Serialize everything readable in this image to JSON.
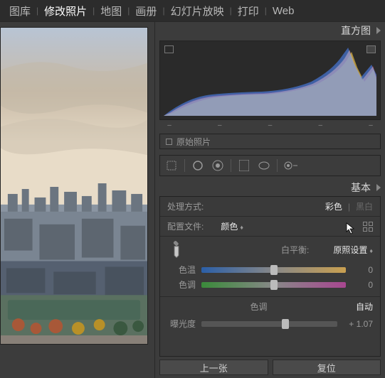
{
  "nav": {
    "library": "图库",
    "develop": "修改照片",
    "map": "地图",
    "book": "画册",
    "slideshow": "幻灯片放映",
    "print": "打印",
    "web": "Web"
  },
  "histogram": {
    "title": "直方图",
    "original_label": "原始照片"
  },
  "basic": {
    "title": "基本",
    "treatment_label": "处理方式:",
    "color": "彩色",
    "bw": "黑白",
    "profile_label": "配置文件:",
    "profile_value": "颜色",
    "wb_label": "白平衡:",
    "wb_value": "原照设置",
    "temp_label": "色温",
    "temp_value": "0",
    "tint_label": "色调",
    "tint_value": "0",
    "tone_title": "色调",
    "auto": "自动",
    "exposure_label": "曝光度",
    "exposure_value": "+ 1.07"
  },
  "footer": {
    "prev": "上一张",
    "reset": "复位"
  }
}
